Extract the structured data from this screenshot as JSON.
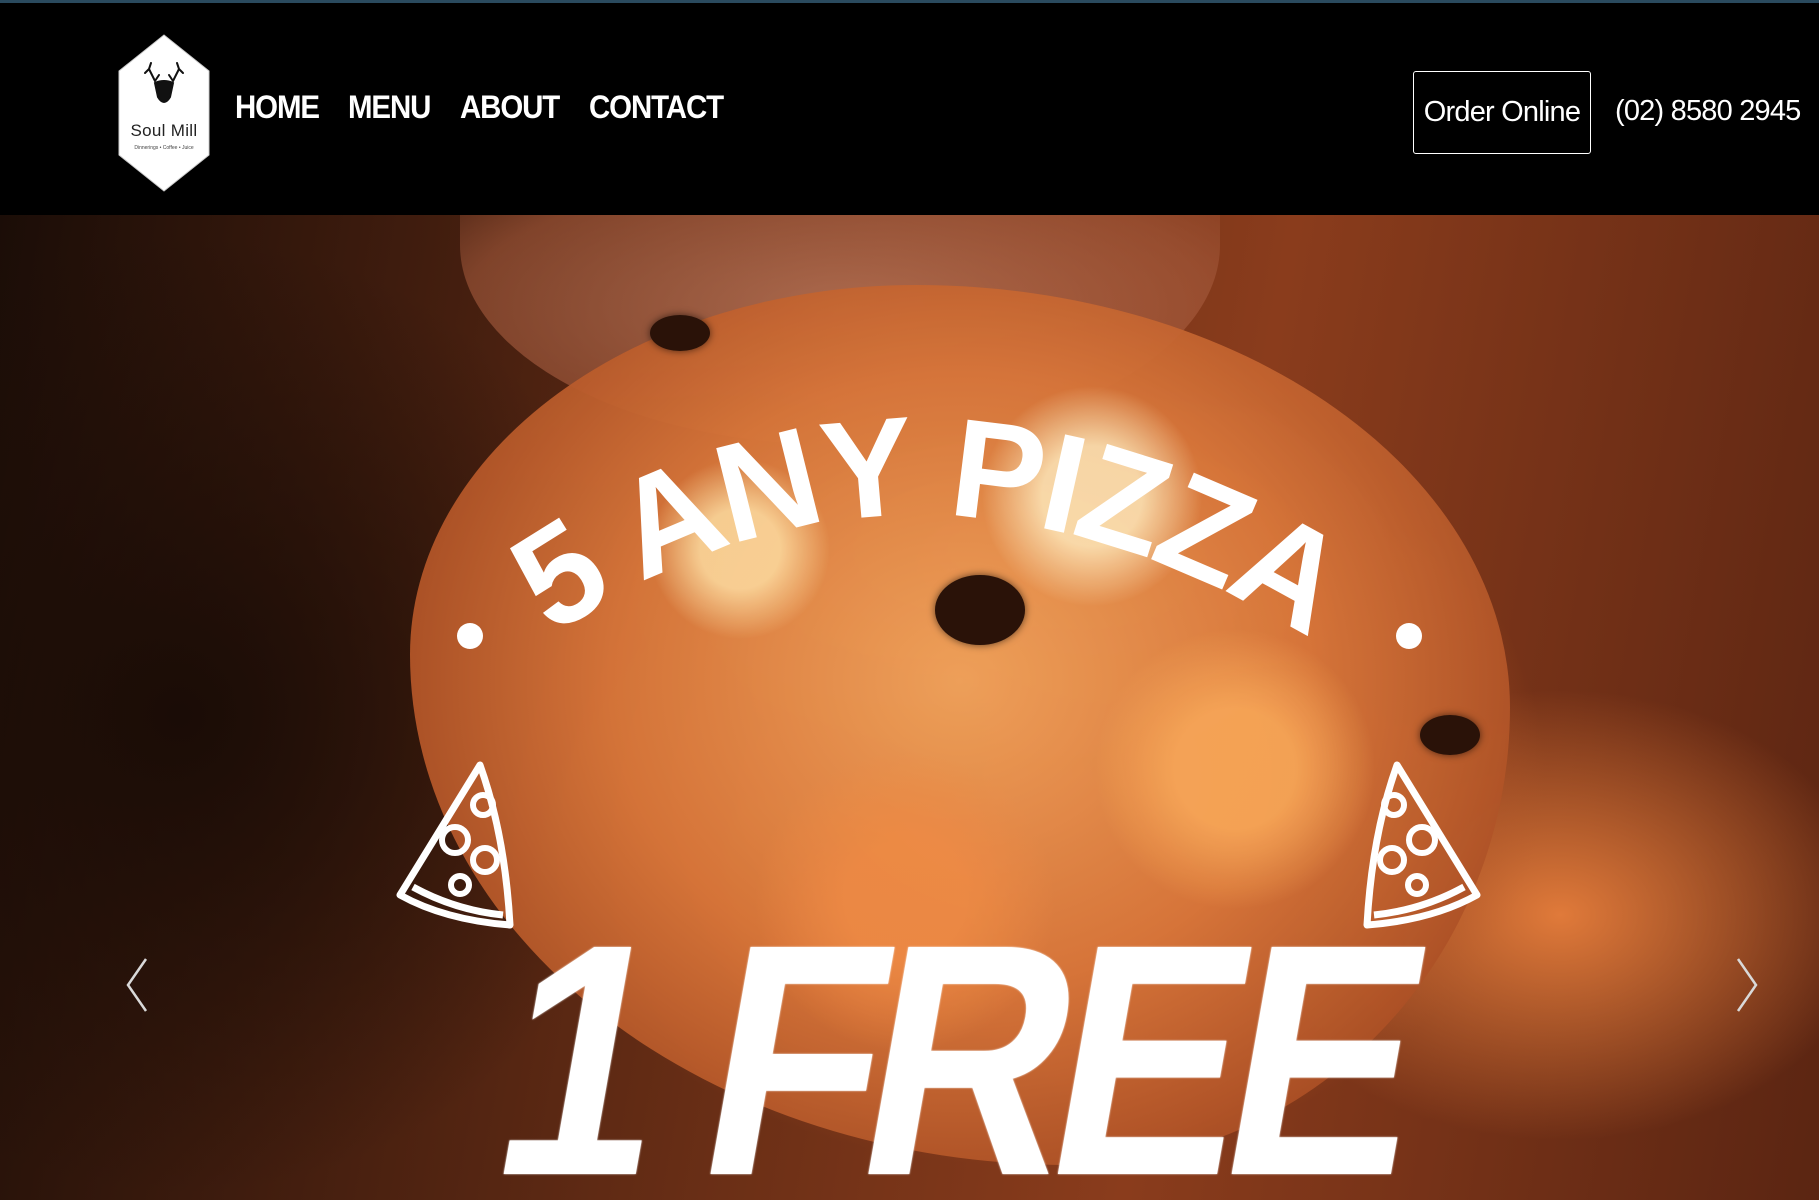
{
  "header": {
    "logo": {
      "name": "Soul Mill",
      "tagline": "Dinnerings • Coffee • Juice"
    },
    "nav": [
      {
        "label": "HOME"
      },
      {
        "label": "MENU"
      },
      {
        "label": "ABOUT"
      },
      {
        "label": "CONTACT"
      }
    ],
    "order_button": "Order Online",
    "phone": "(02) 8580 2945"
  },
  "hero": {
    "promo_line1": "5 ANY PIZZA",
    "promo_line2": "1 FREE",
    "prev_icon": "chevron-left-icon",
    "next_icon": "chevron-right-icon",
    "slice_icon": "pizza-slice-icon"
  },
  "colors": {
    "header_bg": "#000000",
    "text": "#ffffff",
    "top_border": "#2a4a5e"
  }
}
